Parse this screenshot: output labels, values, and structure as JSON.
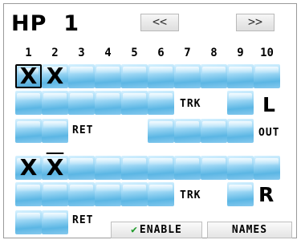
{
  "header": {
    "title": "HP",
    "channel": "1",
    "prev_label": "<<",
    "next_label": ">>"
  },
  "columns": [
    "1",
    "2",
    "3",
    "4",
    "5",
    "6",
    "7",
    "8",
    "9",
    "10"
  ],
  "left": {
    "side_label": "L",
    "marks": [
      "X",
      "X"
    ],
    "trk_label": "TRK",
    "ret_label": "RET",
    "out_label": "OUT"
  },
  "right": {
    "side_label": "R",
    "marks": [
      "X",
      "X"
    ],
    "trk_label": "TRK",
    "ret_label": "RET"
  },
  "buttons": {
    "enable_label": "ENABLE",
    "names_label": "NAMES"
  },
  "colors": {
    "cell_light": "#d6f1ff",
    "cell_dark": "#5bb6e4",
    "enable_check": "#1f9b2a"
  }
}
